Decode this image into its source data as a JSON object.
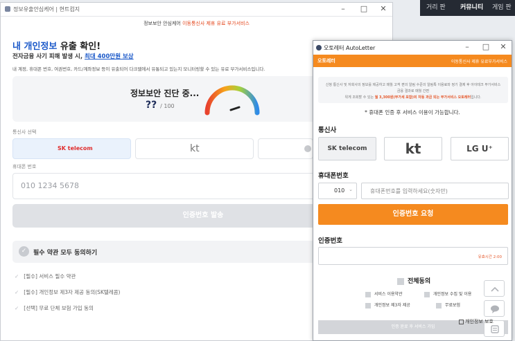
{
  "bg_window": {
    "title": "정보유출안심케어 | 현트컴지",
    "subbar_prefix": "정보보안 안심케어",
    "subbar_highlight": "이동통신사 제휴 유료 부가서비스",
    "heading_blue": "내 개인정보",
    "heading_rest": " 유출 확인!",
    "sub_heading_prefix": "전자금융 사기 피해 발생 시, ",
    "sub_heading_link": "최대 400만원 보상",
    "description": "내 계정, 휴대폰 번호, 여권번호, 카드/계좌정보 등이 유출되어 다크웹에서 유통되고 있는지 모니터링할 수 있는 유료 부가서비스입니다.",
    "diagnosis_title": "정보보안 진단 중...",
    "diagnosis_score": "??",
    "diagnosis_max": "/ 100",
    "carrier_label": "통신사 선택",
    "carriers": [
      "SK telecom",
      "kt",
      ""
    ],
    "phone_label": "휴대폰 번호",
    "phone_placeholder": "010 1234 5678",
    "request_button": "인증번호 발송",
    "agree_all": "필수 약관 모두 동의하기",
    "terms": [
      "[필수] 서비스 필수 약관",
      "[필수] 개인정보 제3자 제공 동의(SK텔레콤)",
      "[선택] 무료 단체 보험 가입 동의"
    ]
  },
  "strip": {
    "items": [
      "거리 판",
      "커뮤니티",
      "게임 판"
    ]
  },
  "fg_window": {
    "title": "오토레터 AutoLetter",
    "orange_left": "오토레터",
    "orange_right": "이동통신사 제휴 유료부가서비스",
    "notice_line1": "신청 통신사 및 자회사의 정보를 제공하고 매월 고객 편의 알림 수준의 알림톡 이용료와 정기 결제 후 아이테크 부가서비스 금융 결과로 매월 간편",
    "notice_line2_prefix": "위게 조회할 수 있는 ",
    "notice_line2_highlight": "월 3,300원(부가세 포함)의 자동 과금 되는 부가서비스 오토레터",
    "notice_line2_suffix": "입니다.",
    "service_note": "* 휴대폰 인증 후 서비스 이용이 가능합니다.",
    "carrier_section": "통신사",
    "carriers": [
      "SK telecom",
      "kt",
      "LG U⁺"
    ],
    "phone_section": "휴대폰번호",
    "prefix_select": "010",
    "phone_placeholder": "휴대폰번호를 입력하세요(숫자만)",
    "request_button": "인증번호 요청",
    "code_section": "인증번호",
    "code_timer": "유효시간 2:00",
    "agree_all": "전체동의",
    "sub_agreements": [
      "서비스 이용약관",
      "개인정보 수집 및 이용",
      "개인정보 제3자 제공",
      "무료보험"
    ],
    "bottom_bar_text": "인증 완료 후 서비스 가입"
  },
  "overlay": {
    "bottom_check_label": "개인정보 보호"
  },
  "colors": {
    "accent_orange": "#f58a1f",
    "link_blue": "#1b59c9",
    "highlight_red": "#e4471d"
  }
}
